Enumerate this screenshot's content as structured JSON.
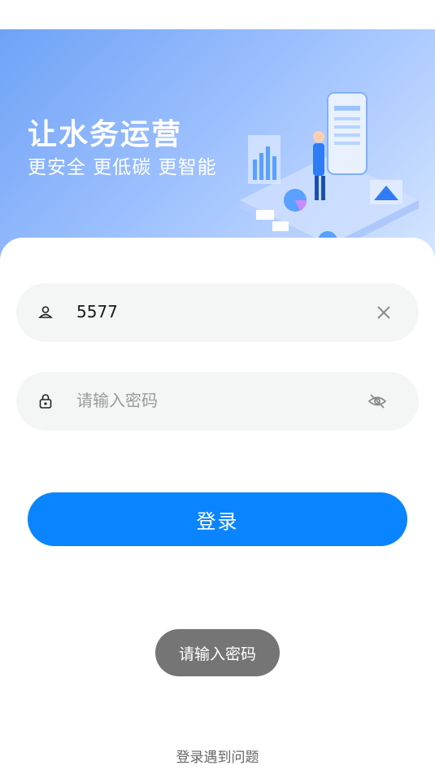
{
  "hero": {
    "title": "让水务运营",
    "subtitle": "更安全 更低碳 更智能"
  },
  "form": {
    "username": {
      "value": "5577",
      "icon": "user-icon",
      "action_icon": "clear-icon"
    },
    "password": {
      "value": "",
      "placeholder": "请输入密码",
      "icon": "lock-icon",
      "action_icon": "eye-off-icon"
    },
    "login_label": "登录"
  },
  "toast": {
    "text": "请输入密码"
  },
  "footer": {
    "help_label": "登录遇到问题"
  },
  "colors": {
    "primary": "#0a85ff",
    "field_bg": "#f4f6f5",
    "toast_bg": "#757575"
  }
}
